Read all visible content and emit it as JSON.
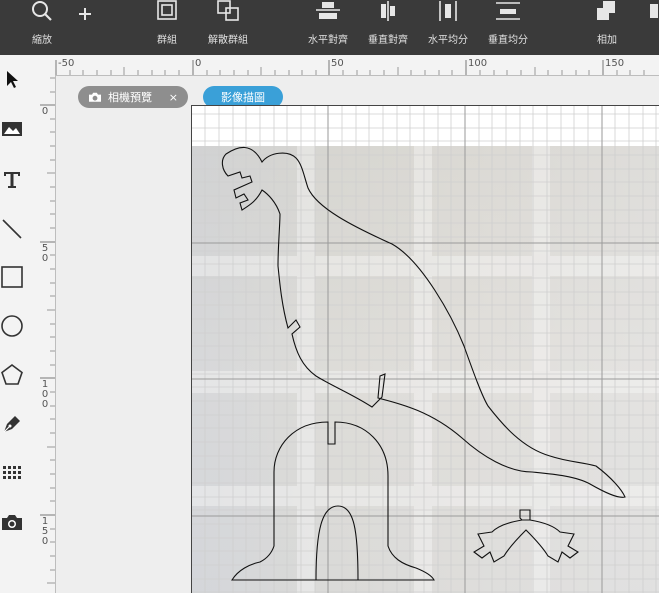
{
  "toolbar": {
    "zoom_label": "縮放",
    "group_label": "群組",
    "ungroup_label": "解散群組",
    "align_horizontal_label": "水平對齊",
    "align_vertical_label": "垂直對齊",
    "distribute_horizontal_label": "水平均分",
    "distribute_vertical_label": "垂直均分",
    "add_label": "相加"
  },
  "ruler_top": {
    "labels": [
      "-50",
      "0",
      "50",
      "100",
      "150"
    ]
  },
  "ruler_left": {
    "labels": [
      "0",
      "50",
      "100",
      "150"
    ]
  },
  "tabs": {
    "camera_preview": "相機預覽",
    "close_mark": "×",
    "image_trace": "影像描圖"
  },
  "colors": {
    "toolbar_bg": "#3a3a3a",
    "tab_inactive": "#8e8e8e",
    "tab_active": "#3aa0d8"
  },
  "icons": [
    "search-icon",
    "plus-icon",
    "group-icon",
    "ungroup-icon",
    "align-horizontal-icon",
    "align-vertical-icon",
    "distribute-horizontal-icon",
    "distribute-vertical-icon",
    "union-icon",
    "cursor-icon",
    "image-icon",
    "text-icon",
    "line-icon",
    "rectangle-icon",
    "circle-icon",
    "pentagon-icon",
    "pen-icon",
    "grid-icon",
    "camera-icon"
  ]
}
